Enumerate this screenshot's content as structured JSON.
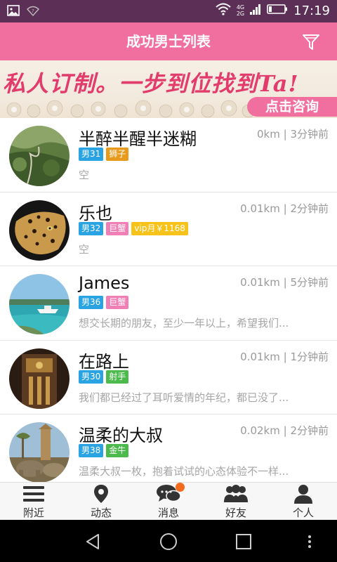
{
  "status_bar": {
    "time": "17:19",
    "network": [
      "4G",
      "2G"
    ],
    "colors": {
      "background": "#5b2f56"
    },
    "icons": [
      "image-icon",
      "wifi-question-icon",
      "wifi-icon",
      "signal-icon",
      "battery-icon"
    ]
  },
  "header": {
    "title": "成功男士列表",
    "filter_icon": "filter-icon",
    "color": "#f06f9f"
  },
  "banner": {
    "headline": "私人订制。一步到位找到Ta!",
    "cta_label": "点击咨询"
  },
  "list": {
    "items": [
      {
        "name": "半醉半醒半迷糊",
        "distance": "0km",
        "time": "3分钟前",
        "tags": [
          {
            "label": "男31",
            "color": "#2aa3e3"
          },
          {
            "label": "狮子",
            "color": "#e89a1c"
          }
        ],
        "bio": "空",
        "avatar": "mountain-road-photo"
      },
      {
        "name": "乐也",
        "distance": "0.01km",
        "time": "2分钟前",
        "tags": [
          {
            "label": "男32",
            "color": "#2aa3e3"
          },
          {
            "label": "巨蟹",
            "color": "#f07fb5"
          },
          {
            "label": "vip月￥1168",
            "color": "#f7c21a"
          }
        ],
        "bio": "空",
        "avatar": "leopard-photo"
      },
      {
        "name": "James",
        "distance": "0.01km",
        "time": "5分钟前",
        "tags": [
          {
            "label": "男36",
            "color": "#2aa3e3"
          },
          {
            "label": "巨蟹",
            "color": "#f07fb5"
          }
        ],
        "bio": "想交长期的朋友，至少一年以上，希望我们...",
        "avatar": "beach-boat-photo"
      },
      {
        "name": "在路上",
        "distance": "0.01km",
        "time": "1分钟前",
        "tags": [
          {
            "label": "男30",
            "color": "#2aa3e3"
          },
          {
            "label": "射手",
            "color": "#4cba4c"
          }
        ],
        "bio": "我们都已经过了耳听爱情的年纪，都已没了...",
        "avatar": "night-building-photo"
      },
      {
        "name": "温柔的大叔",
        "distance": "0.02km",
        "time": "2分钟前",
        "tags": [
          {
            "label": "男38",
            "color": "#2aa3e3"
          },
          {
            "label": "金牛",
            "color": "#4cba4c"
          }
        ],
        "bio": "温柔大叔一枚，抱着试试的心态体验不一样...",
        "avatar": "elephant-statue-photo"
      }
    ]
  },
  "bottom_nav": {
    "items": [
      {
        "label": "附近",
        "icon": "menu-lines-icon"
      },
      {
        "label": "动态",
        "icon": "location-pin-icon"
      },
      {
        "label": "消息",
        "icon": "chat-bubbles-icon",
        "badge": true
      },
      {
        "label": "好友",
        "icon": "group-icon"
      },
      {
        "label": "个人",
        "icon": "person-icon"
      }
    ]
  },
  "system_nav": {
    "icons": [
      "back-icon",
      "home-icon",
      "recents-icon",
      "more-icon"
    ]
  }
}
